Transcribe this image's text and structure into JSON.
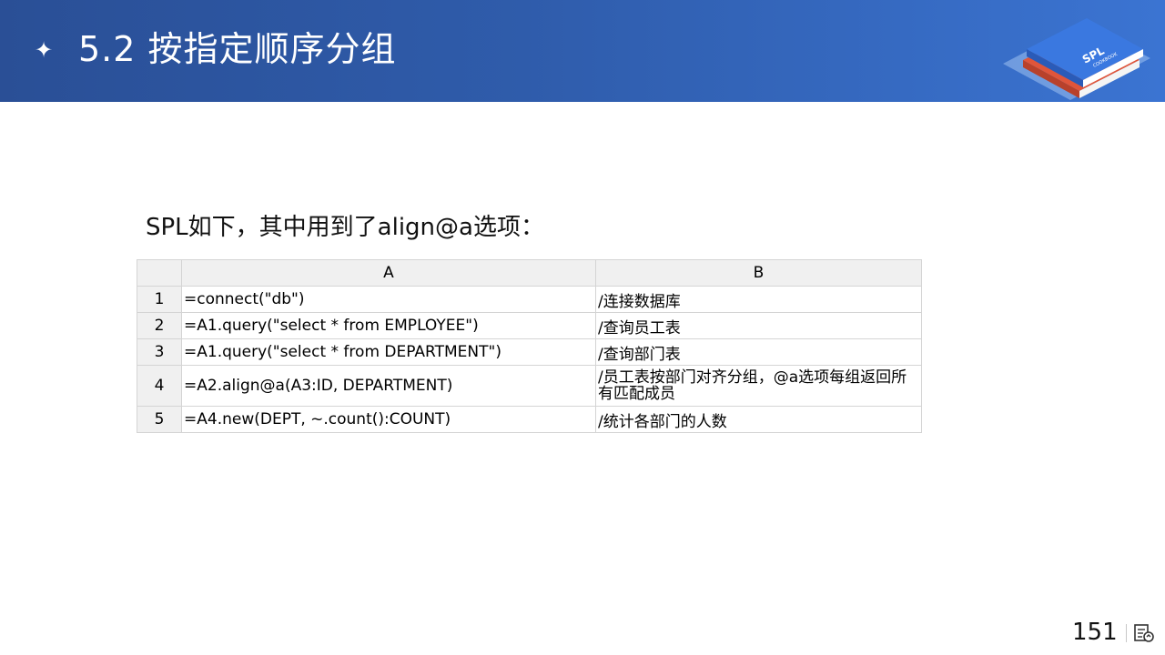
{
  "slide": {
    "star_glyph": "✦",
    "title": "5.2  按指定顺序分组",
    "logo": {
      "line1": "SPL",
      "line2": "COOKBOOK"
    },
    "intro": "SPL如下，其中用到了align@a选项：",
    "page_number": "151",
    "colors": {
      "header_start": "#2a4f96",
      "header_end": "#3b74d2",
      "book_blue": "#3a78e0",
      "book_red": "#e0553a"
    }
  },
  "grid": {
    "columns": [
      "A",
      "B"
    ],
    "rows": [
      {
        "num": "1",
        "a": "=connect(\"db\")",
        "b": "/连接数据库"
      },
      {
        "num": "2",
        "a": "=A1.query(\"select * from EMPLOYEE\")",
        "b": "/查询员工表"
      },
      {
        "num": "3",
        "a": "=A1.query(\"select * from DEPARTMENT\")",
        "b": "/查询部门表"
      },
      {
        "num": "4",
        "a": "=A2.align@a(A3:ID, DEPARTMENT)",
        "b": "/员工表按部门对齐分组，@a选项每组返回所有匹配成员"
      },
      {
        "num": "5",
        "a": "=A4.new(DEPT, ~.count():COUNT)",
        "b": "/统计各部门的人数"
      }
    ]
  }
}
